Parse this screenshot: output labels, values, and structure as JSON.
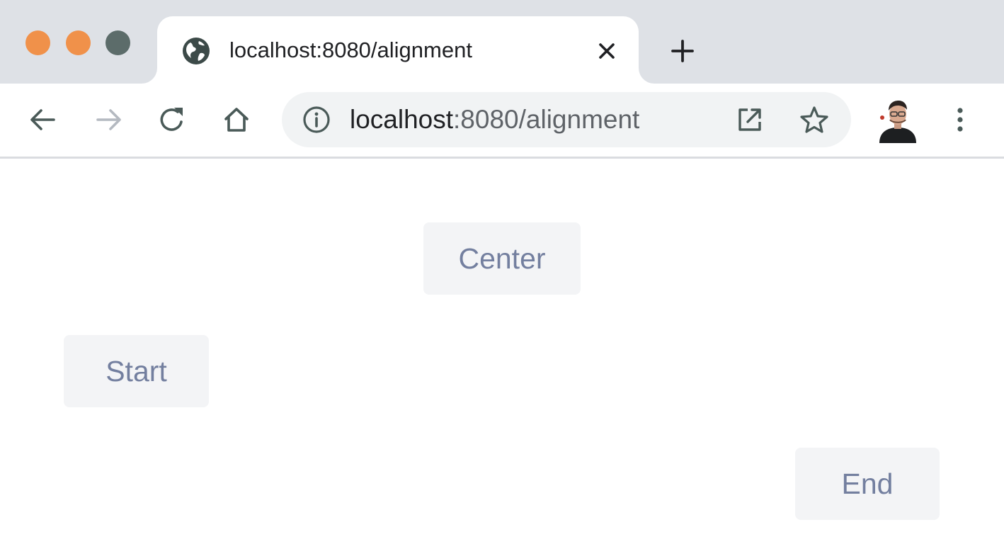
{
  "window": {
    "traffic_lights": {
      "close_color": "#f0914a",
      "minimize_color": "#f0914a",
      "zoom_color": "#5c6c6a"
    }
  },
  "tab": {
    "title": "localhost:8080/alignment",
    "favicon": "globe-icon",
    "close_icon": "close-icon"
  },
  "new_tab_icon": "plus-icon",
  "toolbar": {
    "back_icon": "arrow-left-icon",
    "forward_icon": "arrow-right-icon",
    "reload_icon": "reload-icon",
    "home_icon": "home-icon",
    "address": {
      "info_icon": "info-icon",
      "host": "localhost",
      "path": ":8080/alignment",
      "open_icon": "open-in-new-icon",
      "bookmark_icon": "star-icon"
    },
    "avatar": "profile-avatar",
    "menu_icon": "more-vertical-icon"
  },
  "page": {
    "buttons": {
      "center": "Center",
      "start": "Start",
      "end": "End"
    }
  },
  "colors": {
    "chrome_background": "#dee1e6",
    "omnibox_background": "#f1f3f4",
    "button_background": "#f3f4f6",
    "button_text": "#737f9f",
    "icon_color": "#4a5a58"
  }
}
